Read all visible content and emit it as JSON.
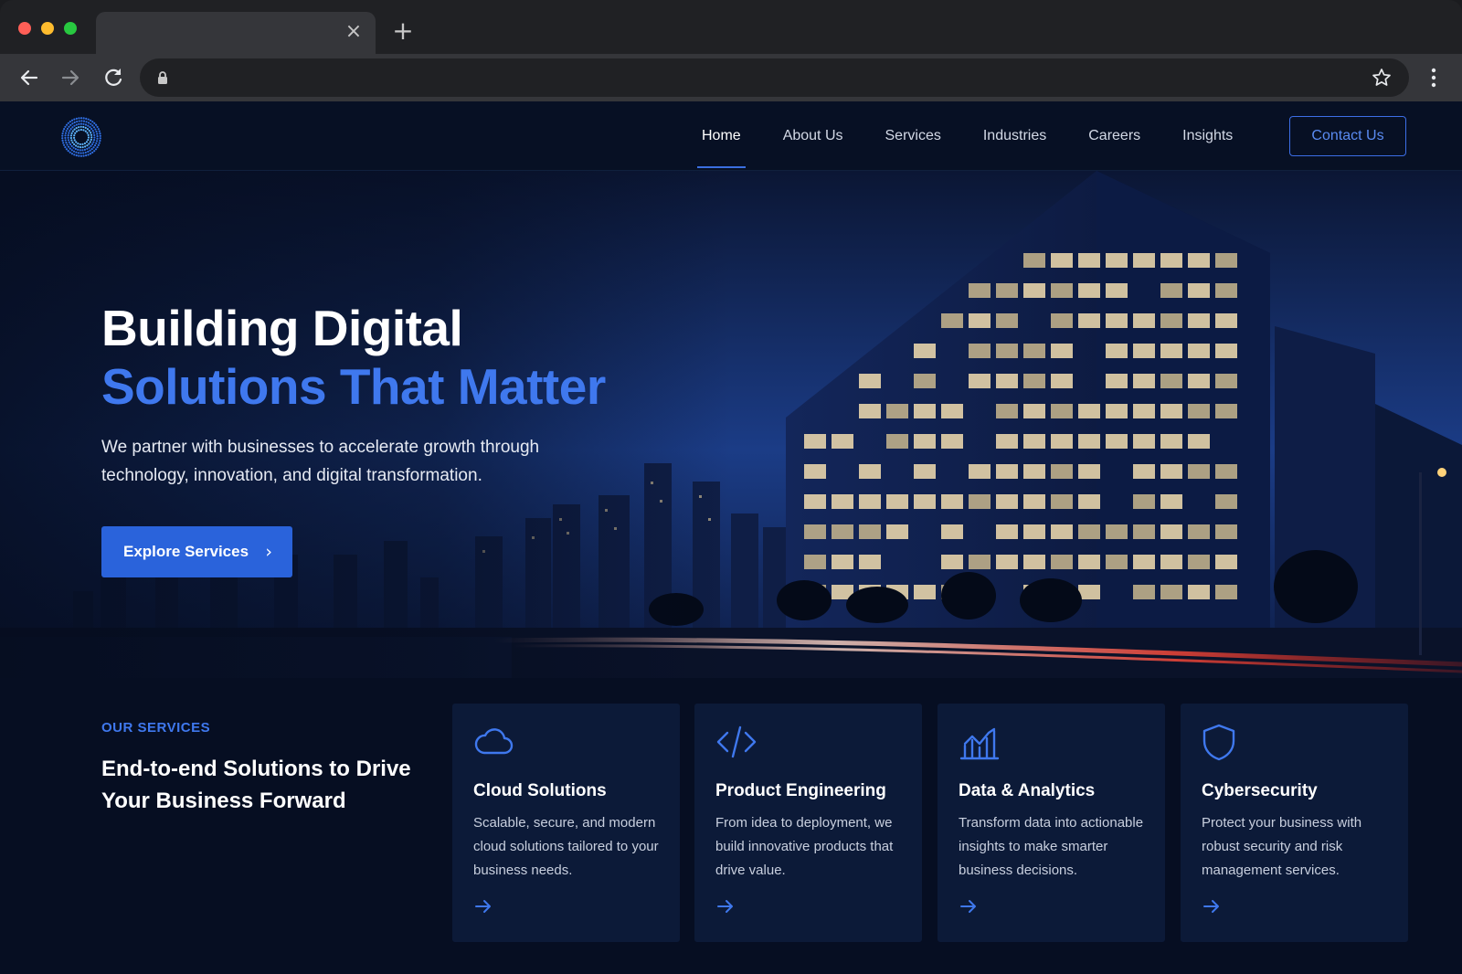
{
  "browser": {
    "tab_title": "",
    "url": "",
    "icons": [
      "back-arrow-icon",
      "forward-arrow-icon",
      "reload-icon",
      "lock-icon",
      "bookmark-star-icon",
      "menu-dots-icon",
      "close-icon",
      "plus-icon"
    ]
  },
  "nav": {
    "logo": "logo-icon",
    "links": [
      {
        "label": "Home",
        "active": true
      },
      {
        "label": "About Us"
      },
      {
        "label": "Services"
      },
      {
        "label": "Industries"
      },
      {
        "label": "Careers"
      },
      {
        "label": "Insights"
      }
    ],
    "contact_label": "Contact Us"
  },
  "hero": {
    "title_line1": "Building Digital",
    "title_line2": "Solutions That Matter",
    "subtitle": "We partner with businesses to accelerate growth through technology, innovation, and digital transformation.",
    "cta_label": "Explore Services",
    "cta_icon": "chevron-right-icon"
  },
  "services": {
    "eyebrow": "OUR SERVICES",
    "heading": "End-to-end Solutions to Drive Your Business Forward",
    "cards": [
      {
        "icon": "cloud-icon",
        "title": "Cloud Solutions",
        "description": "Scalable, secure, and modern cloud solutions tailored to your business needs."
      },
      {
        "icon": "code-icon",
        "title": "Product Engineering",
        "description": "From idea to deployment, we build innovative products that drive value."
      },
      {
        "icon": "analytics-chart-icon",
        "title": "Data & Analytics",
        "description": "Transform data into actionable insights to make smarter business decisions."
      },
      {
        "icon": "shield-icon",
        "title": "Cybersecurity",
        "description": "Protect your business with robust security and risk management services."
      }
    ]
  },
  "colors": {
    "accent": "#3f78ee",
    "button": "#2a63db",
    "background": "#050c1c",
    "card": "#0c1a38"
  }
}
